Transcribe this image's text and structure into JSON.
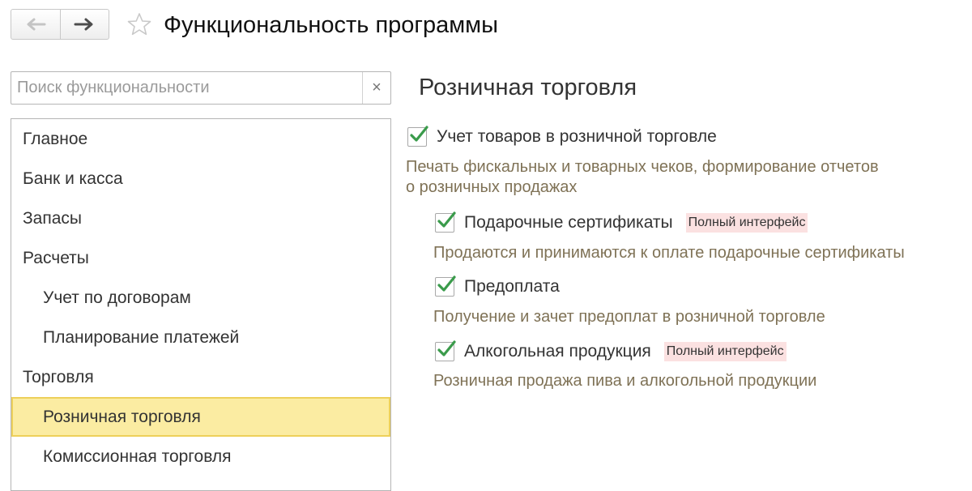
{
  "window": {
    "title": "Функциональность программы"
  },
  "toolbar": {
    "back_icon": "arrow-left-icon",
    "forward_icon": "arrow-right-icon",
    "favorite_icon": "star-icon"
  },
  "search": {
    "placeholder": "Поиск функциональности",
    "value": "",
    "clear_label": "×"
  },
  "sidebar": {
    "items": [
      {
        "label": "Главное",
        "level": 0,
        "selected": false
      },
      {
        "label": "Банк и касса",
        "level": 0,
        "selected": false
      },
      {
        "label": "Запасы",
        "level": 0,
        "selected": false
      },
      {
        "label": "Расчеты",
        "level": 0,
        "selected": false
      },
      {
        "label": "Учет по договорам",
        "level": 1,
        "selected": false
      },
      {
        "label": "Планирование платежей",
        "level": 1,
        "selected": false
      },
      {
        "label": "Торговля",
        "level": 0,
        "selected": false
      },
      {
        "label": "Розничная торговля",
        "level": 1,
        "selected": true
      },
      {
        "label": "Комиссионная торговля",
        "level": 1,
        "selected": false
      }
    ]
  },
  "main": {
    "title": "Розничная торговля",
    "options": [
      {
        "label": "Учет товаров в розничной торговле",
        "checked": true,
        "badge": "",
        "description": "Печать фискальных и товарных чеков, формирование отчетов",
        "description2": "о розничных продажах"
      },
      {
        "label": "Подарочные сертификаты",
        "checked": true,
        "badge": "Полный интерфейс",
        "description": "Продаются и принимаются к оплате подарочные сертификаты"
      },
      {
        "label": "Предоплата",
        "checked": true,
        "badge": "",
        "description": "Получение и зачет предоплат в розничной торговле"
      },
      {
        "label": "Алкогольная продукция",
        "checked": true,
        "badge": "Полный интерфейс",
        "description": "Розничная продажа пива и алкогольной продукции"
      }
    ]
  },
  "colors": {
    "accent_check": "#3a9b4b",
    "selected_bg": "#fbeca2",
    "selected_border": "#edd05a",
    "description_text": "#7f7256",
    "badge_bg": "#fbe1e1"
  }
}
